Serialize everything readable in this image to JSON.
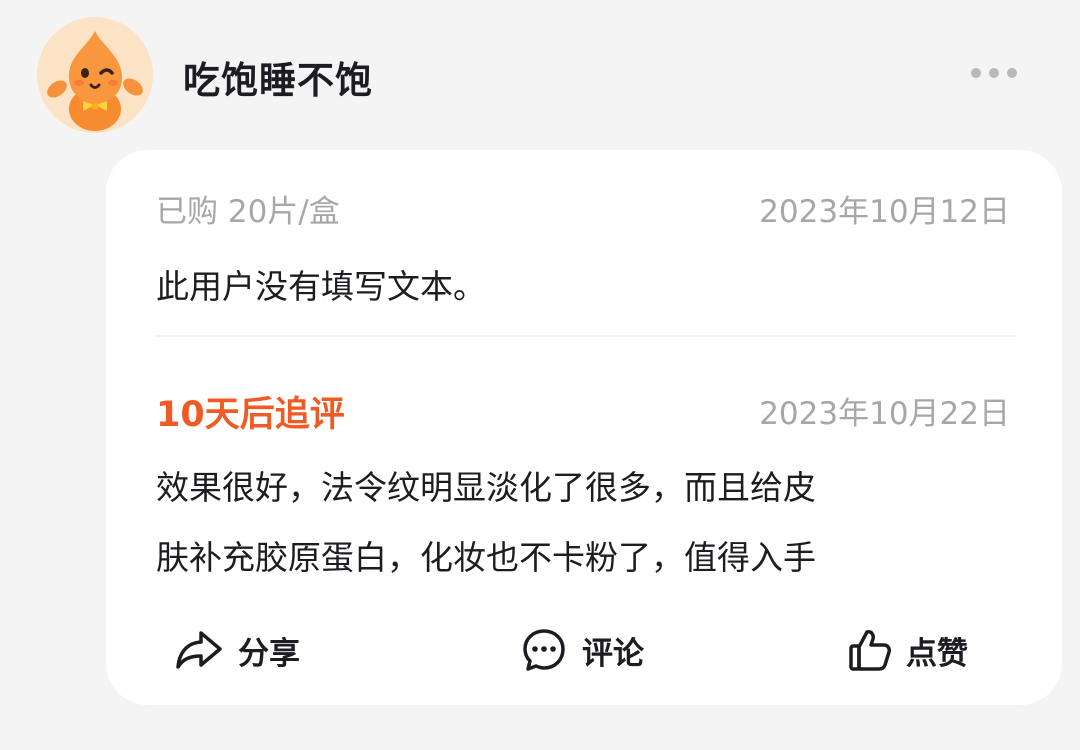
{
  "header": {
    "username": "吃饱睡不饱",
    "avatar_icon": "orange-mascot-avatar",
    "more_icon": "more-dots-icon"
  },
  "review": {
    "purchase_spec": "已购 20片/盒",
    "date": "2023年10月12日",
    "text": "此用户没有填写文本。"
  },
  "followup": {
    "title": "10天后追评",
    "date": "2023年10月22日",
    "lines": [
      "效果很好，法令纹明显淡化了很多，而且给皮",
      "肤补充胶原蛋白，化妆也不卡粉了，值得入手"
    ]
  },
  "actions": {
    "share": {
      "label": "分享",
      "icon": "share-icon"
    },
    "comment": {
      "label": "评论",
      "icon": "comment-icon"
    },
    "like": {
      "label": "点赞",
      "icon": "thumbs-up-icon"
    }
  },
  "colors": {
    "accent": "#f05a23",
    "background": "#f4f4f5",
    "card": "#ffffff",
    "muted_text": "#a7a7ab",
    "primary_text": "#1c1c22"
  }
}
